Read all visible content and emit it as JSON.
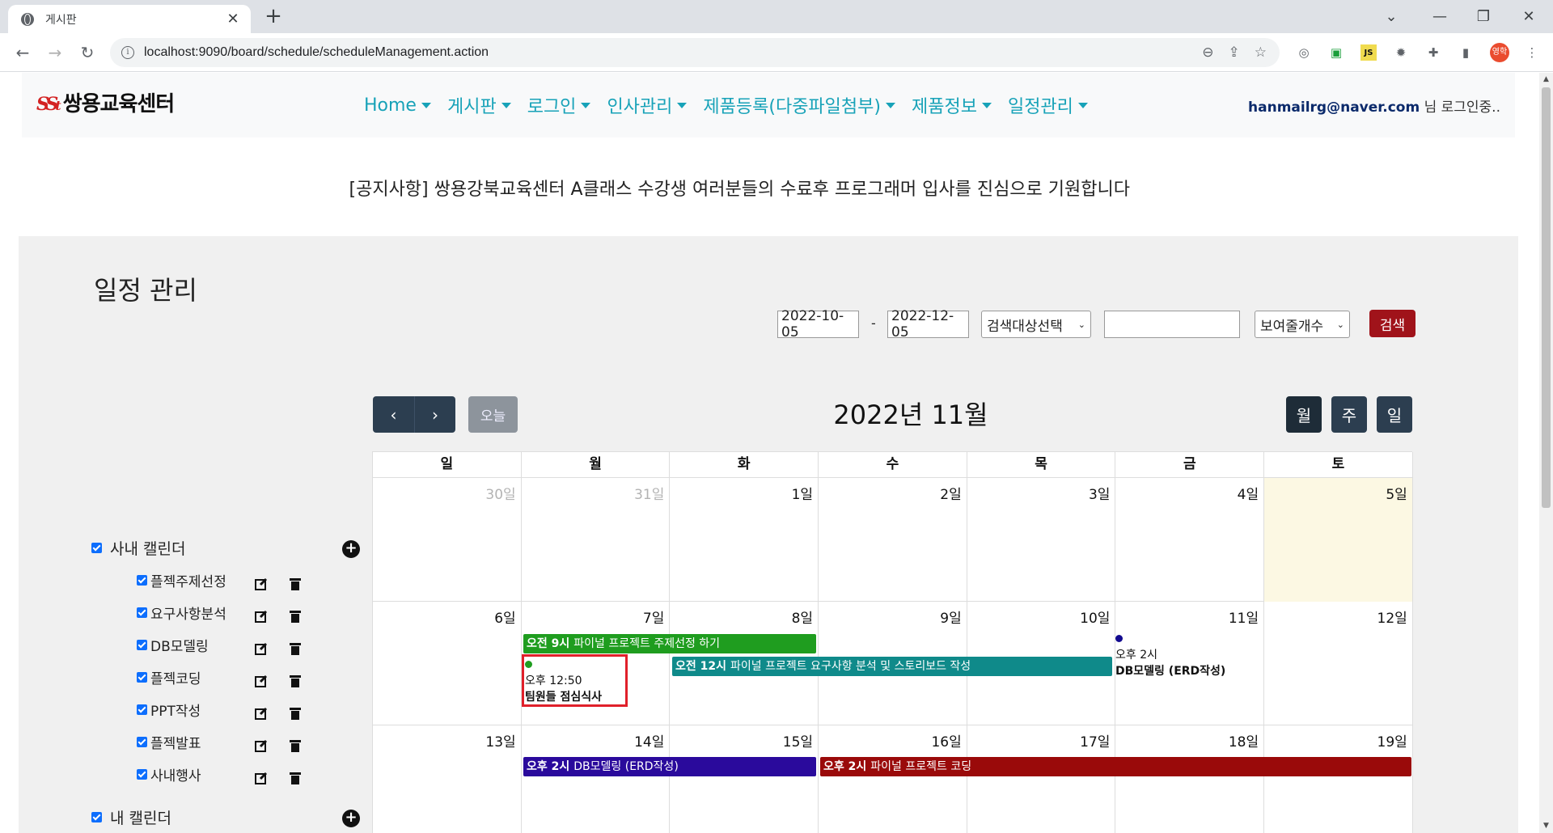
{
  "browser": {
    "tab_title": "게시판",
    "url": "localhost:9090/board/schedule/scheduleManagement.action",
    "profile_label": "영학"
  },
  "site": {
    "logo_mark": "SS",
    "logo_mark_sub": "t",
    "logo_name": "쌍용교육센터",
    "nav": [
      "Home",
      "게시판",
      "로그인",
      "인사관리",
      "제품등록(다중파일첨부)",
      "제품정보",
      "일정관리"
    ],
    "user_email": "hanmailrg@naver.com",
    "user_suffix": " 님 로그인중..",
    "notice": "[공지사항] 쌍용강북교육센터 A클래스 수강생 여러분들의 수료후 프로그래머 입사를 진심으로 기원합니다"
  },
  "page": {
    "title": "일정 관리",
    "search": {
      "start_date": "2022-10-05",
      "dash": "-",
      "end_date": "2022-12-05",
      "target_select": "검색대상선택",
      "keyword": "",
      "count_select": "보여줄개수",
      "button": "검색"
    }
  },
  "calendar": {
    "title": "2022년 11월",
    "today_button": "오늘",
    "views": [
      "월",
      "주",
      "일"
    ],
    "weekdays": [
      "일",
      "월",
      "화",
      "수",
      "목",
      "금",
      "토"
    ],
    "weeks": [
      [
        "30일",
        "31일",
        "1일",
        "2일",
        "3일",
        "4일",
        "5일"
      ],
      [
        "6일",
        "7일",
        "8일",
        "9일",
        "10일",
        "11일",
        "12일"
      ],
      [
        "13일",
        "14일",
        "15일",
        "16일",
        "17일",
        "18일",
        "19일"
      ]
    ],
    "events": {
      "ev1": {
        "time": "오전 9시",
        "title": "파이널 프로젝트 주제선정 하기",
        "color": "#2aa02a"
      },
      "ev2": {
        "time": "오전 12시",
        "title": "파이널 프로젝트 요구사항 분석 및 스토리보드 작성",
        "color": "#0f8a8a"
      },
      "ev3": {
        "time": "오후 12:50",
        "title": "팀원들 점심식사",
        "color": "#2aa02a"
      },
      "ev4": {
        "time": "오후 2시",
        "title": "DB모델링 (ERD작성)",
        "color": "#120a8f"
      },
      "ev5": {
        "time": "오후 2시",
        "title": "DB모델링 (ERD작성)",
        "color": "#2a0a9c"
      },
      "ev6": {
        "time": "오후 2시",
        "title": "파이널 프로젝트 코딩",
        "color": "#9a0a0a"
      }
    }
  },
  "sidebar": {
    "company_calendar": "사내 캘린더",
    "sub_calendars": [
      "플젝주제선정",
      "요구사항분석",
      "DB모델링",
      "플젝코딩",
      "PPT작성",
      "플젝발표",
      "사내행사"
    ],
    "my_calendar": "내 캘린더"
  }
}
